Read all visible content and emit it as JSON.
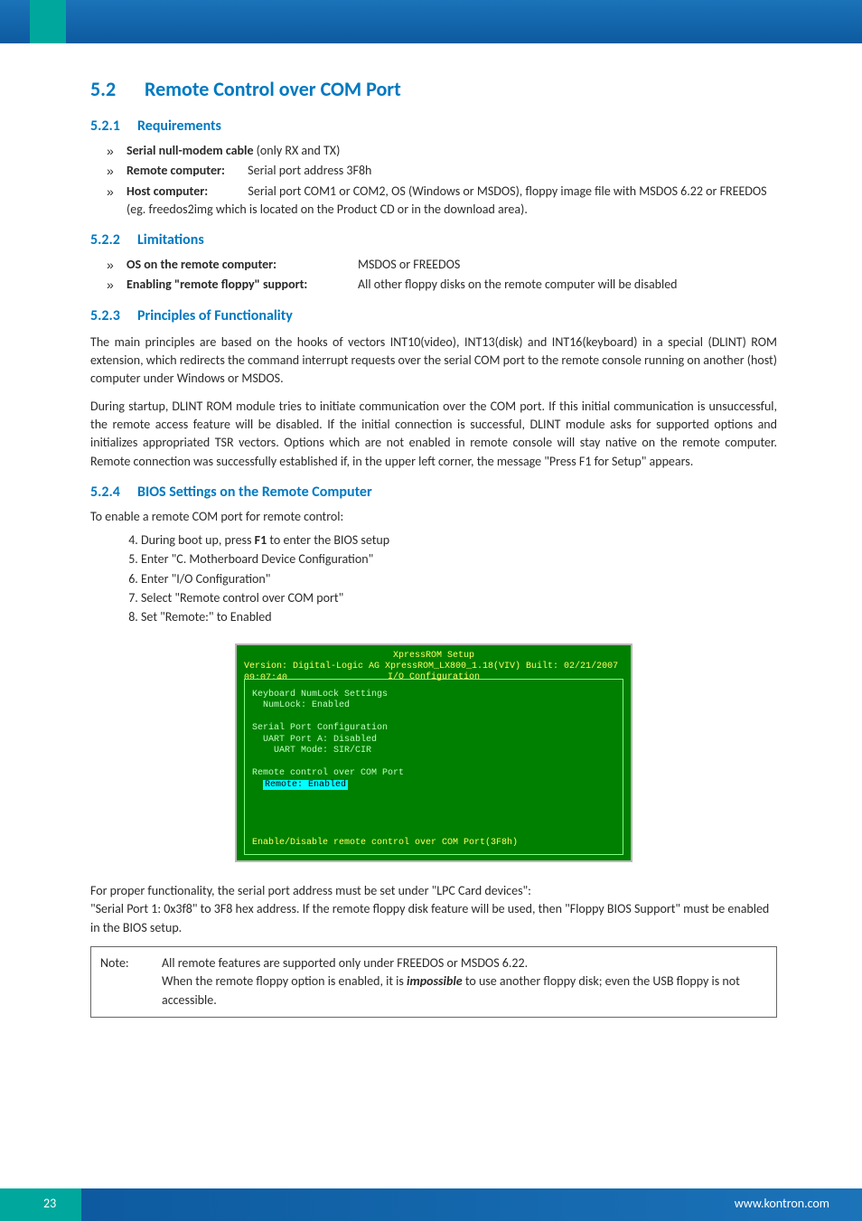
{
  "header": {
    "section_number": "5.2",
    "section_title": "Remote Control over COM Port"
  },
  "sub1": {
    "num": "5.2.1",
    "title": "Requirements",
    "items": [
      {
        "label": "Serial null-modem cable",
        "text": " (only RX and TX)"
      },
      {
        "label": "Remote computer:",
        "text": "        Serial port address 3F8h"
      },
      {
        "label": "Host computer:",
        "text": "              Serial port COM1 or COM2, OS (Windows or MSDOS), floppy image file with MSDOS 6.22 or FREEDOS (eg. freedos2img which is located on the Product CD or in the download area)."
      }
    ]
  },
  "sub2": {
    "num": "5.2.2",
    "title": "Limitations",
    "rows": [
      {
        "label": "OS on the remote computer:",
        "value": "MSDOS or FREEDOS"
      },
      {
        "label": "Enabling \"remote floppy\" support:",
        "value": "All other floppy disks on the remote computer will be disabled"
      }
    ]
  },
  "sub3": {
    "num": "5.2.3",
    "title": "Principles of Functionality",
    "p1": "The main principles are based on the hooks of vectors INT10(video), INT13(disk) and INT16(keyboard) in a special (DLINT) ROM extension, which redirects the command interrupt requests over the serial COM port to the remote console running on another (host) computer under Windows or MSDOS.",
    "p2": "During startup, DLINT ROM module tries to initiate communication over the COM port. If this initial communication is unsuccessful, the remote access feature will be disabled. If the initial connection is successful, DLINT module asks for supported options and initializes appropriated TSR vectors. Options which are not enabled in remote console will stay native on the remote computer. Remote connection was successfully established if, in the upper left corner, the message \"Press F1 for Setup\" appears."
  },
  "sub4": {
    "num": "5.2.4",
    "title": "BIOS Settings on the Remote Computer",
    "intro": "To enable a remote COM port for remote control:",
    "steps": [
      "During boot up, press F1 to enter the BIOS setup",
      "Enter \"C. Motherboard Device Configuration\"",
      "Enter \"I/O Configuration\"",
      "Select \"Remote control over COM port\"",
      "Set \"Remote:\" to Enabled"
    ],
    "steps_start": 4,
    "bios_screen": {
      "title": "XpressROM Setup",
      "version": "Version: Digital-Logic AG XpressROM_LX800_1.18(VIV) Built: 02/21/2007 09:07:40",
      "io_label": "I/O Configuration",
      "lines_group1_head": "Keyboard NumLock Settings",
      "lines_group1_item": "NumLock: Enabled",
      "lines_group2_head": "Serial Port Configuration",
      "lines_group2_item1": "UART Port A: Disabled",
      "lines_group2_item2": "UART Mode: SIR/CIR",
      "lines_group3_head": "Remote control over COM Port",
      "lines_group3_item": "Remote: Enabled",
      "footer": "Enable/Disable remote control over COM Port(3F8h)"
    },
    "post1": "For proper functionality, the serial port address must be set under \"LPC Card devices\":",
    "post2": "\"Serial Port 1: 0x3f8\" to 3F8 hex address. If the remote floppy disk feature will be used, then \"Floppy BIOS Support\" must be enabled in the BIOS setup."
  },
  "note": {
    "label": "Note:",
    "line1": "All remote features are supported only under FREEDOS or MSDOS 6.22.",
    "line2_pre": "When the remote floppy option is enabled, it is ",
    "line2_em": "impossible",
    "line2_post": " to use another floppy disk; even the USB floppy is not accessible."
  },
  "footer": {
    "page": "23",
    "url": "www.kontron.com"
  }
}
